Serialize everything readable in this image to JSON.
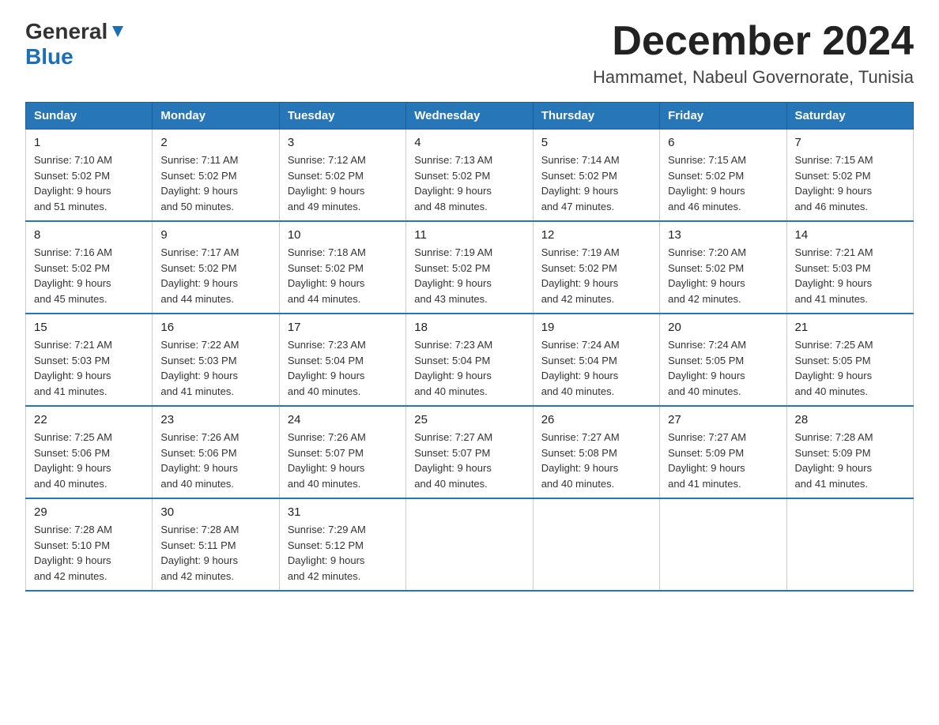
{
  "header": {
    "logo_general": "General",
    "logo_blue": "Blue",
    "month_title": "December 2024",
    "location": "Hammamet, Nabeul Governorate, Tunisia"
  },
  "days_of_week": [
    "Sunday",
    "Monday",
    "Tuesday",
    "Wednesday",
    "Thursday",
    "Friday",
    "Saturday"
  ],
  "weeks": [
    [
      {
        "day": "1",
        "sunrise": "7:10 AM",
        "sunset": "5:02 PM",
        "daylight": "9 hours and 51 minutes."
      },
      {
        "day": "2",
        "sunrise": "7:11 AM",
        "sunset": "5:02 PM",
        "daylight": "9 hours and 50 minutes."
      },
      {
        "day": "3",
        "sunrise": "7:12 AM",
        "sunset": "5:02 PM",
        "daylight": "9 hours and 49 minutes."
      },
      {
        "day": "4",
        "sunrise": "7:13 AM",
        "sunset": "5:02 PM",
        "daylight": "9 hours and 48 minutes."
      },
      {
        "day": "5",
        "sunrise": "7:14 AM",
        "sunset": "5:02 PM",
        "daylight": "9 hours and 47 minutes."
      },
      {
        "day": "6",
        "sunrise": "7:15 AM",
        "sunset": "5:02 PM",
        "daylight": "9 hours and 46 minutes."
      },
      {
        "day": "7",
        "sunrise": "7:15 AM",
        "sunset": "5:02 PM",
        "daylight": "9 hours and 46 minutes."
      }
    ],
    [
      {
        "day": "8",
        "sunrise": "7:16 AM",
        "sunset": "5:02 PM",
        "daylight": "9 hours and 45 minutes."
      },
      {
        "day": "9",
        "sunrise": "7:17 AM",
        "sunset": "5:02 PM",
        "daylight": "9 hours and 44 minutes."
      },
      {
        "day": "10",
        "sunrise": "7:18 AM",
        "sunset": "5:02 PM",
        "daylight": "9 hours and 44 minutes."
      },
      {
        "day": "11",
        "sunrise": "7:19 AM",
        "sunset": "5:02 PM",
        "daylight": "9 hours and 43 minutes."
      },
      {
        "day": "12",
        "sunrise": "7:19 AM",
        "sunset": "5:02 PM",
        "daylight": "9 hours and 42 minutes."
      },
      {
        "day": "13",
        "sunrise": "7:20 AM",
        "sunset": "5:02 PM",
        "daylight": "9 hours and 42 minutes."
      },
      {
        "day": "14",
        "sunrise": "7:21 AM",
        "sunset": "5:03 PM",
        "daylight": "9 hours and 41 minutes."
      }
    ],
    [
      {
        "day": "15",
        "sunrise": "7:21 AM",
        "sunset": "5:03 PM",
        "daylight": "9 hours and 41 minutes."
      },
      {
        "day": "16",
        "sunrise": "7:22 AM",
        "sunset": "5:03 PM",
        "daylight": "9 hours and 41 minutes."
      },
      {
        "day": "17",
        "sunrise": "7:23 AM",
        "sunset": "5:04 PM",
        "daylight": "9 hours and 40 minutes."
      },
      {
        "day": "18",
        "sunrise": "7:23 AM",
        "sunset": "5:04 PM",
        "daylight": "9 hours and 40 minutes."
      },
      {
        "day": "19",
        "sunrise": "7:24 AM",
        "sunset": "5:04 PM",
        "daylight": "9 hours and 40 minutes."
      },
      {
        "day": "20",
        "sunrise": "7:24 AM",
        "sunset": "5:05 PM",
        "daylight": "9 hours and 40 minutes."
      },
      {
        "day": "21",
        "sunrise": "7:25 AM",
        "sunset": "5:05 PM",
        "daylight": "9 hours and 40 minutes."
      }
    ],
    [
      {
        "day": "22",
        "sunrise": "7:25 AM",
        "sunset": "5:06 PM",
        "daylight": "9 hours and 40 minutes."
      },
      {
        "day": "23",
        "sunrise": "7:26 AM",
        "sunset": "5:06 PM",
        "daylight": "9 hours and 40 minutes."
      },
      {
        "day": "24",
        "sunrise": "7:26 AM",
        "sunset": "5:07 PM",
        "daylight": "9 hours and 40 minutes."
      },
      {
        "day": "25",
        "sunrise": "7:27 AM",
        "sunset": "5:07 PM",
        "daylight": "9 hours and 40 minutes."
      },
      {
        "day": "26",
        "sunrise": "7:27 AM",
        "sunset": "5:08 PM",
        "daylight": "9 hours and 40 minutes."
      },
      {
        "day": "27",
        "sunrise": "7:27 AM",
        "sunset": "5:09 PM",
        "daylight": "9 hours and 41 minutes."
      },
      {
        "day": "28",
        "sunrise": "7:28 AM",
        "sunset": "5:09 PM",
        "daylight": "9 hours and 41 minutes."
      }
    ],
    [
      {
        "day": "29",
        "sunrise": "7:28 AM",
        "sunset": "5:10 PM",
        "daylight": "9 hours and 42 minutes."
      },
      {
        "day": "30",
        "sunrise": "7:28 AM",
        "sunset": "5:11 PM",
        "daylight": "9 hours and 42 minutes."
      },
      {
        "day": "31",
        "sunrise": "7:29 AM",
        "sunset": "5:12 PM",
        "daylight": "9 hours and 42 minutes."
      },
      null,
      null,
      null,
      null
    ]
  ],
  "labels": {
    "sunrise": "Sunrise:",
    "sunset": "Sunset:",
    "daylight": "Daylight:"
  }
}
